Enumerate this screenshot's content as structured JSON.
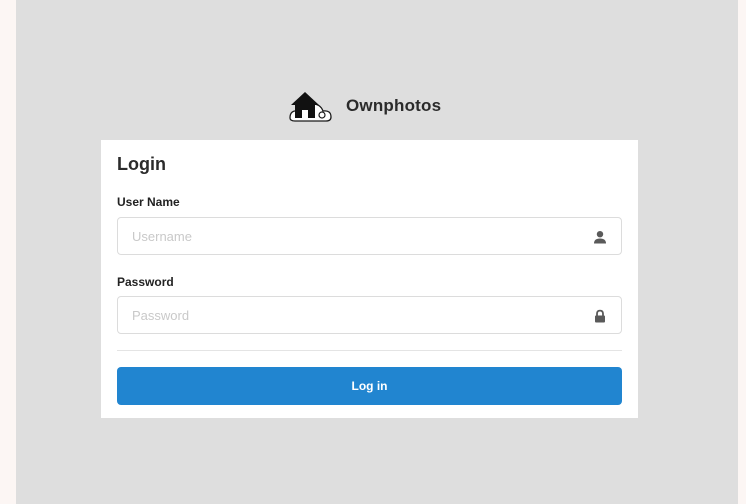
{
  "brand": {
    "name": "Ownphotos",
    "logo_icon": "home-cloud-logo-icon"
  },
  "login_form": {
    "title": "Login",
    "username": {
      "label": "User Name",
      "placeholder": "Username",
      "value": "",
      "icon": "user-icon"
    },
    "password": {
      "label": "Password",
      "placeholder": "Password",
      "value": "",
      "icon": "lock-icon"
    },
    "submit_label": "Log in"
  },
  "colors": {
    "background": "#dedede",
    "card": "#ffffff",
    "primary_button": "#2185d0",
    "text": "#2b2b2b"
  }
}
